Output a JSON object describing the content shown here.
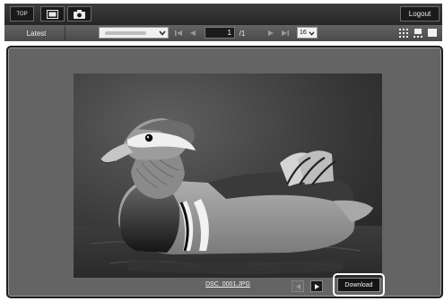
{
  "topbar": {
    "top_label": "TOP",
    "gallery_icon": "image-gallery-icon",
    "camera_icon": "camera-icon",
    "logout_label": "Logout"
  },
  "toolbar": {
    "latest_label": "Latest",
    "folder_select_value": " ",
    "page_input_value": "1",
    "page_total": "/1",
    "per_page_value": "16",
    "icons": [
      "first-page-icon",
      "prev-page-icon",
      "next-page-icon",
      "last-page-icon",
      "grid-view-icon",
      "filmstrip-view-icon",
      "single-view-icon"
    ]
  },
  "viewer": {
    "filename": "DSC_0001.JPG",
    "download_label": "Download",
    "prev_icon": "prev-image-icon",
    "next_icon": "next-image-icon"
  },
  "colors": {
    "topbar": "#2e2e2e",
    "toolbar": "#585858",
    "viewer_bg": "#646464",
    "highlight": "#ffffff"
  }
}
